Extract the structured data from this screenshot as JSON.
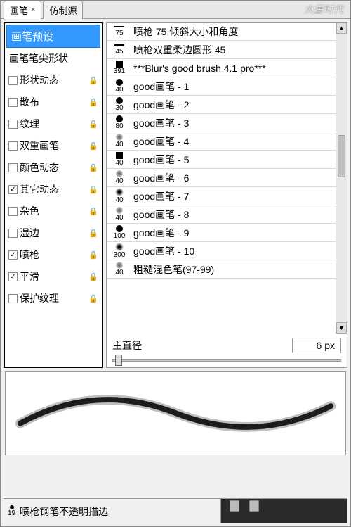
{
  "tabs": {
    "brush": "画笔",
    "clone": "仿制源"
  },
  "watermark": "火星时代",
  "sidebar": {
    "header": "画笔预设",
    "tip_shape": "画笔笔尖形状",
    "items": [
      {
        "label": "形状动态",
        "checked": false
      },
      {
        "label": "散布",
        "checked": false
      },
      {
        "label": "纹理",
        "checked": false
      },
      {
        "label": "双重画笔",
        "checked": false
      },
      {
        "label": "颜色动态",
        "checked": false
      },
      {
        "label": "其它动态",
        "checked": true
      },
      {
        "label": "杂色",
        "checked": false
      },
      {
        "label": "湿边",
        "checked": false
      },
      {
        "label": "喷枪",
        "checked": true
      },
      {
        "label": "平滑",
        "checked": true
      },
      {
        "label": "保护纹理",
        "checked": false
      }
    ]
  },
  "brushes": [
    {
      "size": "75",
      "shape": "dash",
      "label": "喷枪 75 倾斜大小和角度"
    },
    {
      "size": "45",
      "shape": "dash",
      "label": "喷枪双重柔边圆形 45"
    },
    {
      "size": "391",
      "shape": "sq",
      "label": "***Blur's good brush 4.1 pro***"
    },
    {
      "size": "40",
      "shape": "dot",
      "label": "good画笔 - 1"
    },
    {
      "size": "30",
      "shape": "dot",
      "label": "good画笔 - 2"
    },
    {
      "size": "80",
      "shape": "dot",
      "label": "good画笔 - 3"
    },
    {
      "size": "40",
      "shape": "soft",
      "label": "good画笔 - 4"
    },
    {
      "size": "40",
      "shape": "sq",
      "label": "good画笔 - 5"
    },
    {
      "size": "40",
      "shape": "soft",
      "label": "good画笔 - 6"
    },
    {
      "size": "40",
      "shape": "fuzz",
      "label": "good画笔 - 7"
    },
    {
      "size": "40",
      "shape": "soft",
      "label": "good画笔 - 8"
    },
    {
      "size": "100",
      "shape": "dot",
      "label": "good画笔 - 9"
    },
    {
      "size": "300",
      "shape": "fuzz",
      "label": "good画笔 - 10"
    },
    {
      "size": "40",
      "shape": "soft",
      "label": "粗糙混色笔(97-99)"
    }
  ],
  "diameter": {
    "label": "主直径",
    "value": "6 px"
  },
  "bottom": {
    "size": "19",
    "label": "喷枪钢笔不透明描边"
  }
}
